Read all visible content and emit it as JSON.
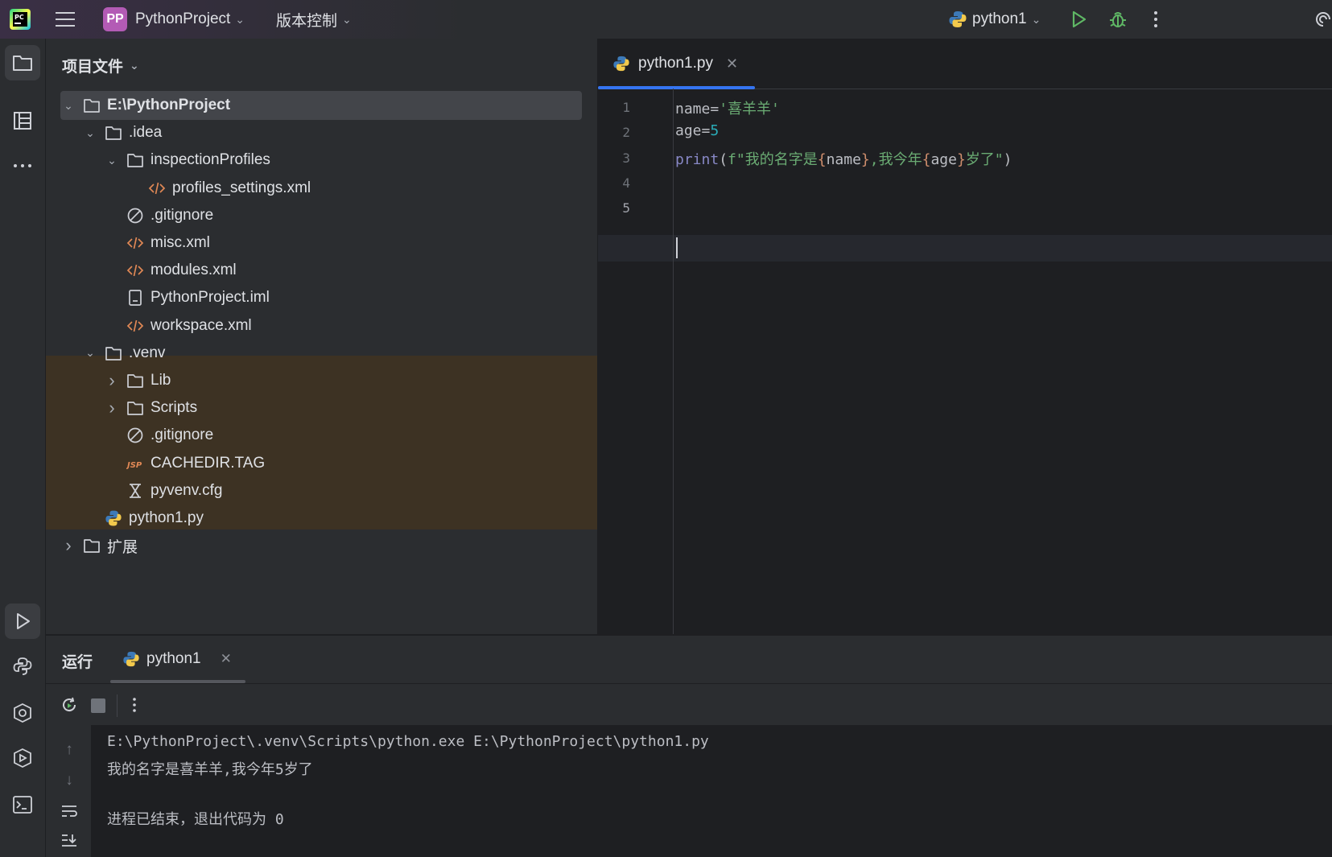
{
  "titlebar": {
    "project_badge": "PP",
    "project_name": "PythonProject",
    "vcs_label": "版本控制",
    "run_config": "python1"
  },
  "project_panel": {
    "title": "项目文件",
    "tree": [
      {
        "label": "E:\\PythonProject",
        "depth": 0,
        "expanded": true,
        "icon": "folder-icon",
        "selected": true
      },
      {
        "label": ".idea",
        "depth": 1,
        "expanded": true,
        "icon": "folder-icon"
      },
      {
        "label": "inspectionProfiles",
        "depth": 2,
        "expanded": true,
        "icon": "folder-icon"
      },
      {
        "label": "profiles_settings.xml",
        "depth": 3,
        "icon": "xml-icon"
      },
      {
        "label": ".gitignore",
        "depth": 2,
        "icon": "ignore-icon"
      },
      {
        "label": "misc.xml",
        "depth": 2,
        "icon": "xml-icon"
      },
      {
        "label": "modules.xml",
        "depth": 2,
        "icon": "xml-icon"
      },
      {
        "label": "PythonProject.iml",
        "depth": 2,
        "icon": "iml-icon"
      },
      {
        "label": "workspace.xml",
        "depth": 2,
        "icon": "xml-icon"
      },
      {
        "label": ".venv",
        "depth": 1,
        "expanded": true,
        "icon": "folder-icon"
      },
      {
        "label": "Lib",
        "depth": 2,
        "expanded": false,
        "icon": "folder-icon"
      },
      {
        "label": "Scripts",
        "depth": 2,
        "expanded": false,
        "icon": "folder-icon"
      },
      {
        "label": ".gitignore",
        "depth": 2,
        "icon": "ignore-icon"
      },
      {
        "label": "CACHEDIR.TAG",
        "depth": 2,
        "icon": "tag-icon"
      },
      {
        "label": "pyvenv.cfg",
        "depth": 2,
        "icon": "cfg-icon"
      },
      {
        "label": "python1.py",
        "depth": 1,
        "icon": "python-icon"
      },
      {
        "label": "扩展",
        "depth": 0,
        "expanded": false,
        "icon": "folder-icon"
      }
    ]
  },
  "editor": {
    "tab_label": "python1.py",
    "line_numbers": [
      "1",
      "2",
      "3",
      "4",
      "5"
    ],
    "lines": [
      [
        {
          "t": "name=",
          "c": "#bcbec4"
        },
        {
          "t": "'喜羊羊'",
          "c": "#6aab73"
        }
      ],
      [
        {
          "t": "age=",
          "c": "#bcbec4"
        },
        {
          "t": "5",
          "c": "#2aacb8"
        }
      ],
      [
        {
          "t": "print",
          "c": "#8888c6"
        },
        {
          "t": "(",
          "c": "#bcbec4"
        },
        {
          "t": "f\"我的名字是",
          "c": "#6aab73"
        },
        {
          "t": "{",
          "c": "#cf8e6d"
        },
        {
          "t": "name",
          "c": "#bcbec4"
        },
        {
          "t": "}",
          "c": "#cf8e6d"
        },
        {
          "t": ",我今年",
          "c": "#6aab73"
        },
        {
          "t": "{",
          "c": "#cf8e6d"
        },
        {
          "t": "age",
          "c": "#bcbec4"
        },
        {
          "t": "}",
          "c": "#cf8e6d"
        },
        {
          "t": "岁了\"",
          "c": "#6aab73"
        },
        {
          "t": ")",
          "c": "#bcbec4"
        }
      ],
      [],
      []
    ]
  },
  "run_panel": {
    "title": "运行",
    "tab_label": "python1",
    "console": [
      "E:\\PythonProject\\.venv\\Scripts\\python.exe E:\\PythonProject\\python1.py",
      "我的名字是喜羊羊,我今年5岁了",
      "",
      "进程已结束，退出代码为 0"
    ]
  },
  "colors": {
    "accent": "#3574f0",
    "run_green": "#5fb865",
    "xml_orange": "#e08855"
  }
}
